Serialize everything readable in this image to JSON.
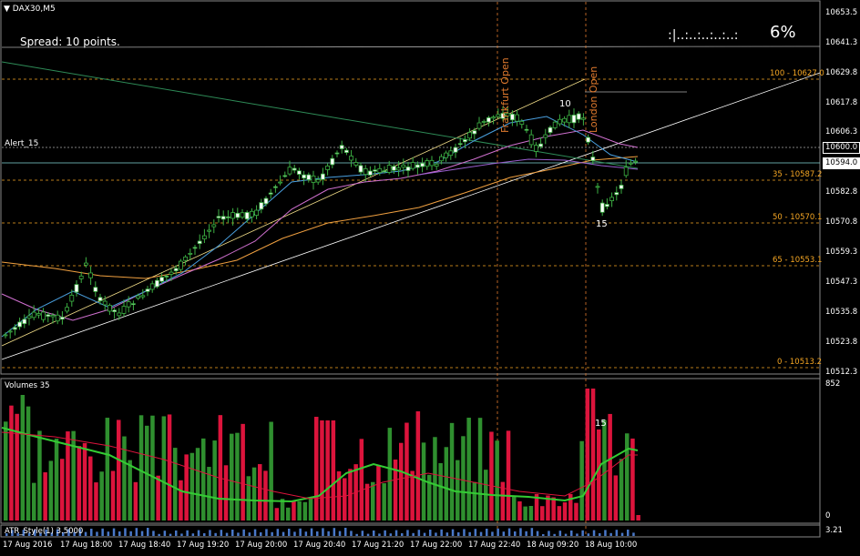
{
  "chart": {
    "symbol_title": "DAX30,M5",
    "spread_text": "Spread: 10 points.",
    "progress_dots": ":|..:..:..:..:..:",
    "progress_pct": "6%",
    "alert_label": "Alert_15",
    "marker_10": "10",
    "marker_15": "15",
    "vol_marker_15": "15",
    "volumes_title": "Volumes 35",
    "atr_title": "ATR_Style(1) 3.5000",
    "vertical_line_labels": [
      "Frankfurt Open",
      "London Open"
    ],
    "price_axis": [
      "10653.5",
      "10641.3",
      "10629.8",
      "10617.8",
      "10606.3",
      "10594.0",
      "10582.8",
      "10570.8",
      "10559.3",
      "10547.3",
      "10535.8",
      "10523.8",
      "10512.3"
    ],
    "current_price_box": "10594.0",
    "alert_price_box": "10600.0",
    "volume_axis_top": "852",
    "volume_axis_zero": "0",
    "atr_axis": "3.21",
    "fib_levels": [
      {
        "label": "100 - 10627.0"
      },
      {
        "label": "35 - 10587.2"
      },
      {
        "label": "50 - 10570.1"
      },
      {
        "label": "65 - 10553.1"
      },
      {
        "label": "0 - 10513.2"
      }
    ],
    "time_axis": [
      "17 Aug 2016",
      "17 Aug 18:00",
      "17 Aug 18:40",
      "17 Aug 19:20",
      "17 Aug 20:00",
      "17 Aug 20:40",
      "17 Aug 21:20",
      "17 Aug 22:00",
      "17 Aug 22:40",
      "18 Aug 09:20",
      "18 Aug 10:00"
    ]
  },
  "colors": {
    "background": "#000000",
    "bull": "#2f8f2f",
    "bear": "#dc143c",
    "fib": "#f5a623",
    "vline": "#e07a2e"
  }
}
